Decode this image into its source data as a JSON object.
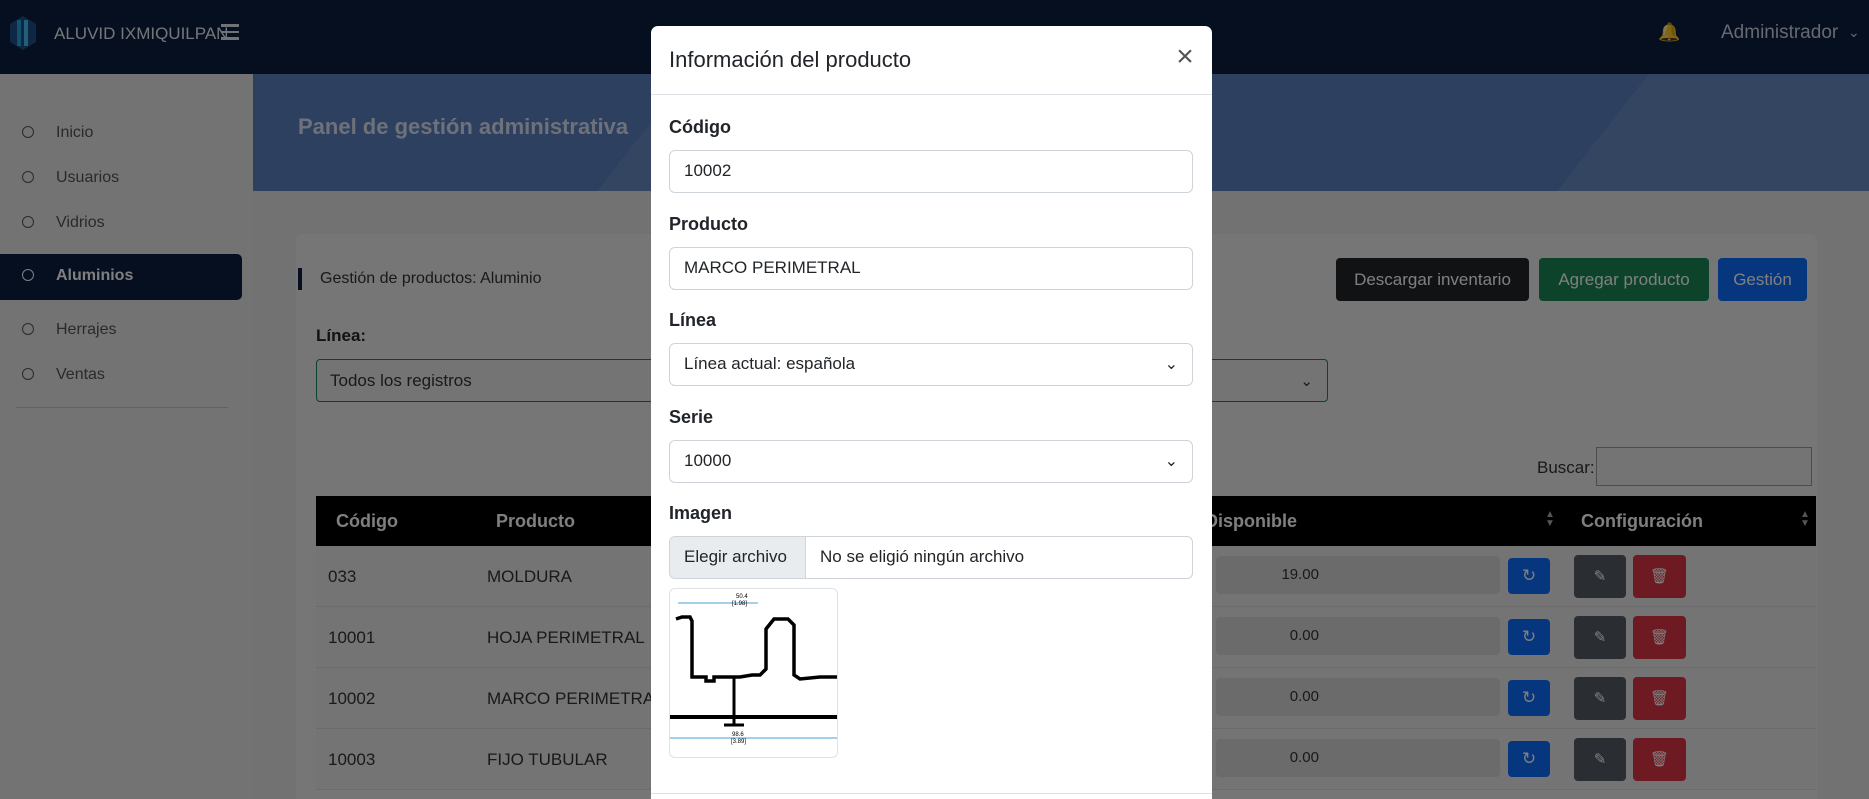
{
  "topbar": {
    "brand": "ALUVID IXMIQUILPAN",
    "user": "Administrador",
    "icons": [
      "logo-icon",
      "hamburger-icon",
      "bell-icon",
      "chevron-down-icon"
    ],
    "colors": {
      "bar": "#0a1f3f",
      "bell": "#dc3545"
    }
  },
  "sidebar": {
    "items": [
      {
        "label": "Inicio",
        "active": false
      },
      {
        "label": "Usuarios",
        "active": false
      },
      {
        "label": "Vidrios",
        "active": false
      },
      {
        "label": "Aluminios",
        "active": true
      },
      {
        "label": "Herrajes",
        "active": false
      },
      {
        "label": "Ventas",
        "active": false
      }
    ]
  },
  "header": {
    "title": "Panel de gestión administrativa"
  },
  "card": {
    "title": "Gestión de productos: Aluminio",
    "buttons": {
      "download": "Descargar inventario",
      "add": "Agregar producto",
      "manage": "Gestión"
    },
    "filter": {
      "label": "Línea:",
      "value": "Todos los registros"
    },
    "search": {
      "label": "Buscar:",
      "value": ""
    }
  },
  "table": {
    "columns": [
      "Código",
      "Producto",
      "Disponible",
      "Configuración"
    ],
    "rows": [
      {
        "code": "033",
        "product": "MOLDURA",
        "available": "19.00"
      },
      {
        "code": "10001",
        "product": "HOJA PERIMETRAL",
        "available": "0.00"
      },
      {
        "code": "10002",
        "product": "MARCO PERIMETRAL",
        "available": "0.00"
      },
      {
        "code": "10003",
        "product": "FIJO TUBULAR",
        "available": "0.00"
      }
    ]
  },
  "modal": {
    "title": "Información del producto",
    "fields": {
      "code_label": "Código",
      "code_value": "10002",
      "product_label": "Producto",
      "product_value": "MARCO PERIMETRAL",
      "line_label": "Línea",
      "line_value": "Línea actual: española",
      "series_label": "Serie",
      "series_value": "10000",
      "image_label": "Imagen",
      "file_button": "Elegir archivo",
      "file_status": "No se eligió ningún archivo"
    },
    "preview": {
      "top_dim": "50.4",
      "top_dim_in": "[1.98]",
      "bottom_dim": "98.6",
      "bottom_dim_in": "[3.89]"
    }
  }
}
